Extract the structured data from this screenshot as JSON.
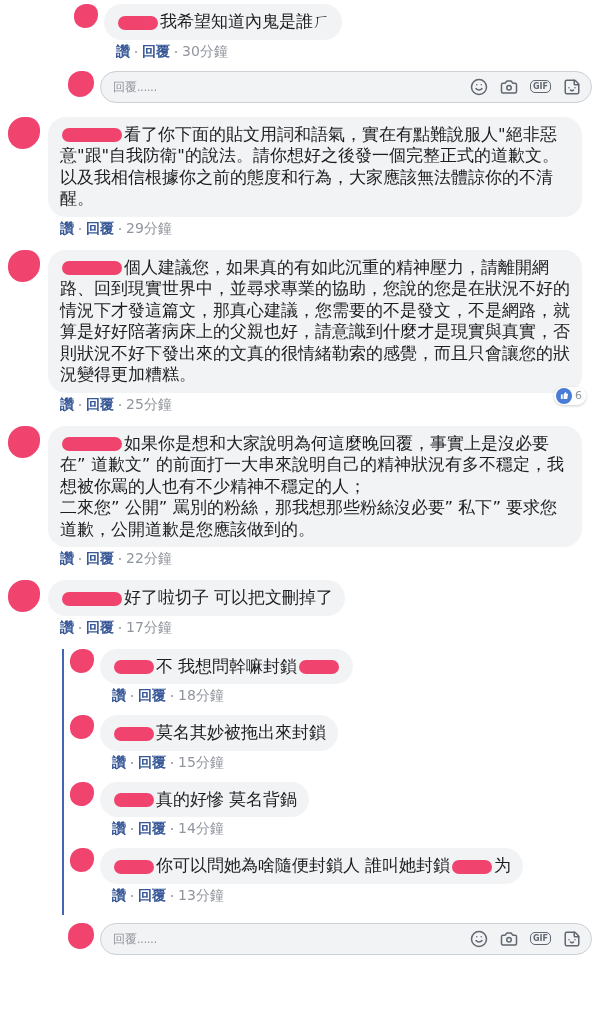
{
  "earlier_thread": {
    "replies": [
      {
        "text": "我希望知道內鬼是誰ㄏ",
        "actions": {
          "like": "讚",
          "reply": "回覆",
          "time": "30分鐘"
        }
      }
    ],
    "reply_box": {
      "placeholder": "回覆......",
      "gif_label": "GIF"
    }
  },
  "comments": [
    {
      "paragraphs": [
        "看了你下面的貼文用詞和語氣，實在有點難說服人\"絕非惡意\"跟\"自我防衛\"的說法。請你想好之後發一個完整正式的道歉文。",
        "以及我相信根據你之前的態度和行為，大家應該無法體諒你的不清醒。"
      ],
      "actions": {
        "like": "讚",
        "reply": "回覆",
        "time": "29分鐘"
      }
    },
    {
      "text": "個人建議您，如果真的有如此沉重的精神壓力，請離開網路、回到現實世界中，並尋求專業的協助，您說的您是在狀況不好的情況下才發這篇文，那真心建議，您需要的不是發文，不是網路，就算是好好陪著病床上的父親也好，請意識到什麼才是現實與真實，否則狀況不好下發出來的文真的很情緒勒索的感覺，而且只會讓您的狀況變得更加糟糕。",
      "likes": "6",
      "actions": {
        "like": "讚",
        "reply": "回覆",
        "time": "25分鐘"
      }
    },
    {
      "paragraphs": [
        "如果你是想和大家說明為何這麼晚回覆，事實上是沒必要在” 道歉文” 的前面打一大串來說明自己的精神狀況有多不穩定，我想被你罵的人也有不少精神不穩定的人；",
        "二來您” 公開” 罵別的粉絲，那我想那些粉絲沒必要” 私下” 要求您道歉，公開道歉是您應該做到的。"
      ],
      "actions": {
        "like": "讚",
        "reply": "回覆",
        "time": "22分鐘"
      }
    },
    {
      "text": "好了啦切子 可以把文刪掉了",
      "actions": {
        "like": "讚",
        "reply": "回覆",
        "time": "17分鐘"
      },
      "replies": [
        {
          "text": "不 我想問幹嘛封鎖",
          "redaction_after": true,
          "actions": {
            "like": "讚",
            "reply": "回覆",
            "time": "18分鐘"
          }
        },
        {
          "text": "莫名其妙被拖出來封鎖",
          "actions": {
            "like": "讚",
            "reply": "回覆",
            "time": "15分鐘"
          }
        },
        {
          "text": "真的好慘 莫名背鍋",
          "actions": {
            "like": "讚",
            "reply": "回覆",
            "time": "14分鐘"
          }
        },
        {
          "text": "你可以問她為啥隨便封鎖人 誰叫她封鎖",
          "redaction_after": true,
          "trailing_text": "为",
          "actions": {
            "like": "讚",
            "reply": "回覆",
            "time": "13分鐘"
          }
        }
      ],
      "reply_box": {
        "placeholder": "回覆......",
        "gif_label": "GIF"
      }
    }
  ]
}
